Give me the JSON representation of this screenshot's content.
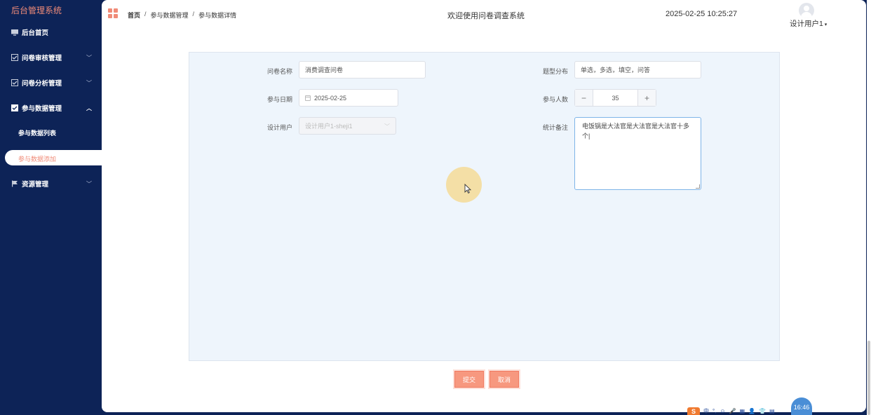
{
  "sidebar": {
    "brand": "后台管理系统",
    "items": [
      {
        "label": "后台首页",
        "icon": "monitor-icon"
      },
      {
        "label": "问卷审核管理",
        "icon": "checkbox-icon"
      },
      {
        "label": "问卷分析管理",
        "icon": "checkbox-icon"
      },
      {
        "label": "参与数据管理",
        "icon": "checkbox-icon"
      },
      {
        "label": "资源管理",
        "icon": "flag-icon"
      }
    ],
    "sub_items": [
      {
        "label": "参与数据列表"
      },
      {
        "label": "参与数据添加",
        "active": true
      }
    ]
  },
  "header": {
    "breadcrumb": [
      "首页",
      "参与数据管理",
      "参与数据详情"
    ],
    "breadcrumb_sep": "/",
    "welcome": "欢迎使用问卷调查系统",
    "datetime": "2025-02-25 10:25:27",
    "user": "设计用户1"
  },
  "form": {
    "survey_name": {
      "label": "问卷名称",
      "value": "消费调查问卷"
    },
    "question_types": {
      "label": "题型分布",
      "value": "单选，多选，填空，问答"
    },
    "date": {
      "label": "参与日期",
      "value": "2025-02-25"
    },
    "participants": {
      "label": "参与人数",
      "value": "35",
      "minus": "−",
      "plus": "+"
    },
    "designer": {
      "label": "设计用户",
      "value": "设计用户1-sheji1"
    },
    "remark": {
      "label": "统计备注",
      "value": "电饭锅是大法官是大法官是大法官十多个|"
    }
  },
  "buttons": {
    "submit": "提交",
    "cancel": "取消"
  },
  "taskbar": {
    "time": "16:46",
    "ime_logo": "S",
    "ime_items": [
      "中",
      "°,",
      "☺",
      "🎤",
      "▦",
      "👤",
      "👕",
      "▤"
    ]
  },
  "colors": {
    "sidebar_bg": "#0d2357",
    "accent": "#f08b78",
    "button": "#f7987f",
    "panel_bg": "#eef5fc"
  }
}
